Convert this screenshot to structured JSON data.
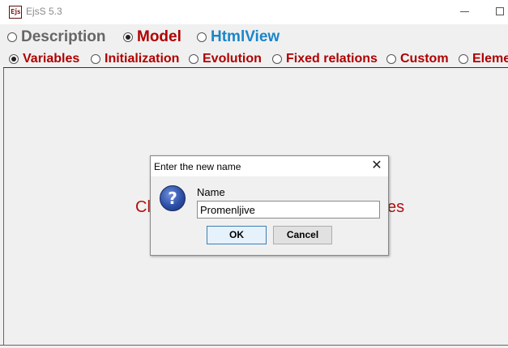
{
  "window": {
    "app_icon_text": "Ejs",
    "title": "EjsS 5.3"
  },
  "main_tabs": [
    {
      "label": "Description",
      "color": "#666666",
      "selected": false
    },
    {
      "label": "Model",
      "color": "#b00000",
      "selected": true
    },
    {
      "label": "HtmlView",
      "color": "#1a86c8",
      "selected": false
    }
  ],
  "sub_tabs": [
    {
      "label": "Variables",
      "selected": true
    },
    {
      "label": "Initialization",
      "selected": false
    },
    {
      "label": "Evolution",
      "selected": false
    },
    {
      "label": "Fixed relations",
      "selected": false
    },
    {
      "label": "Custom",
      "selected": false
    },
    {
      "label": "Eleme",
      "selected": false
    }
  ],
  "background_message": {
    "left_fragment": "Cl",
    "right_fragment": "es"
  },
  "dialog": {
    "title": "Enter the new name",
    "icon": "question-icon",
    "field_label": "Name",
    "field_value": "Promenljive",
    "ok_label": "OK",
    "cancel_label": "Cancel"
  },
  "colors": {
    "accent_red": "#b00000",
    "accent_blue": "#1a86c8",
    "inactive_gray": "#666666"
  }
}
